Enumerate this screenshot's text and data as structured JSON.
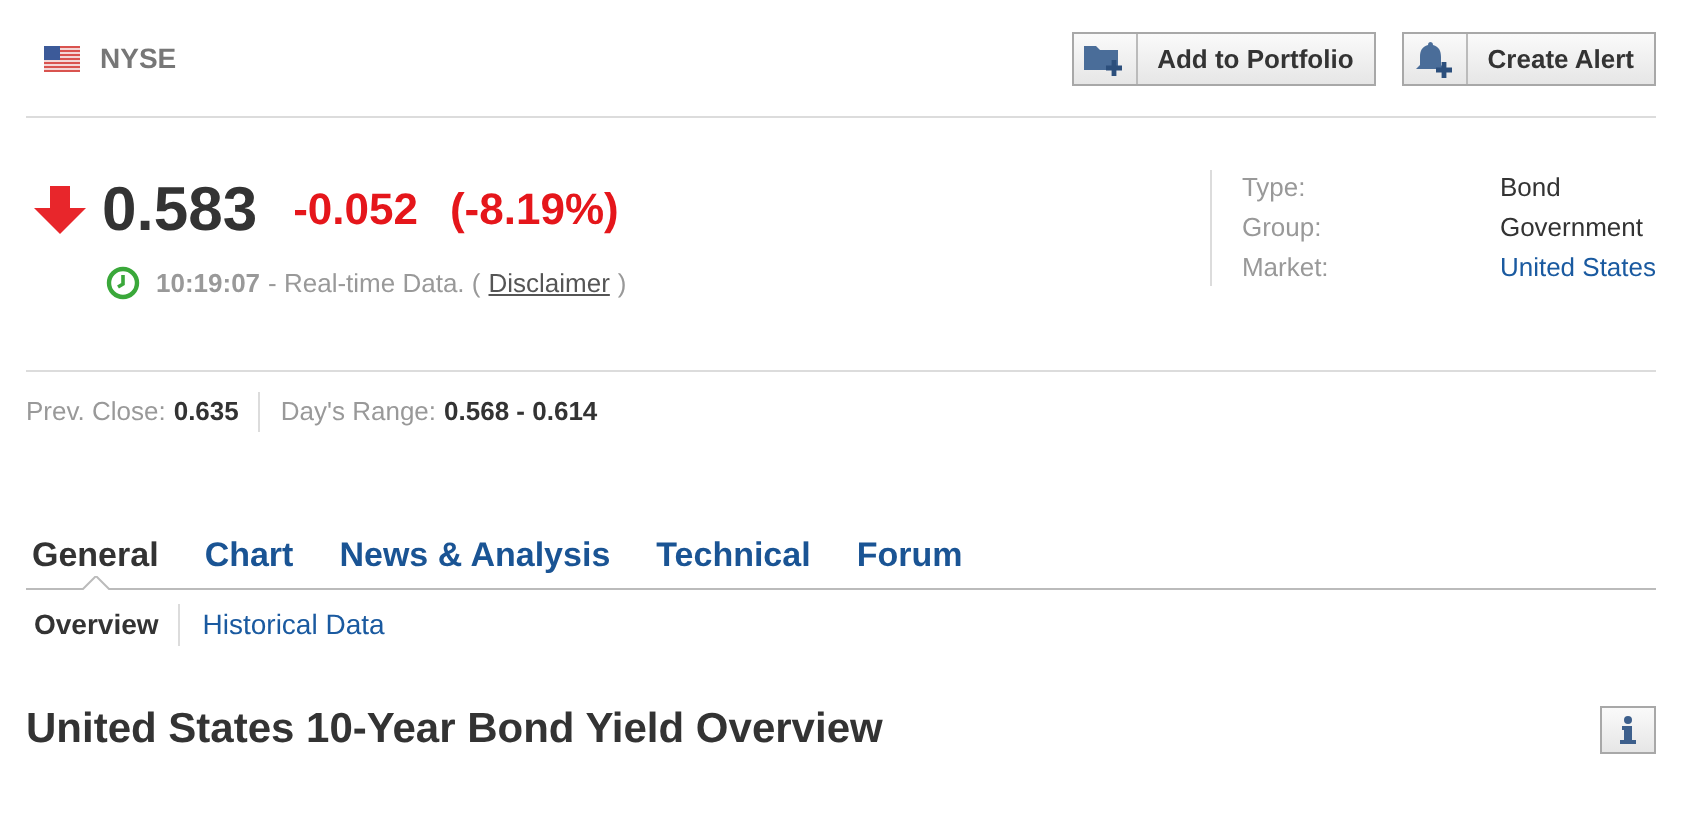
{
  "exchange": "NYSE",
  "actions": [
    {
      "label": "Add to Portfolio",
      "kind": "portfolio"
    },
    {
      "label": "Create Alert",
      "kind": "alert"
    }
  ],
  "quote": {
    "kind": "down",
    "price": "0.583",
    "change": "-0.052",
    "change_percent": "(-8.19%)",
    "time": "10:19:07",
    "realtime_note": "- Real-time Data. (",
    "disclaimer": "Disclaimer",
    "close_paren": ")"
  },
  "info": [
    {
      "label": "Type:",
      "value": "Bond",
      "link": false
    },
    {
      "label": "Group:",
      "value": "Government",
      "link": false
    },
    {
      "label": "Market:",
      "value": "United States",
      "link": true
    }
  ],
  "stats": [
    {
      "label": "Prev. Close:",
      "value": "0.635"
    },
    {
      "label": "Day's Range:",
      "value": "0.568 - 0.614"
    }
  ],
  "tabs": [
    {
      "label": "General",
      "selected": true
    },
    {
      "label": "Chart",
      "selected": false
    },
    {
      "label": "News & Analysis",
      "selected": false
    },
    {
      "label": "Technical",
      "selected": false
    },
    {
      "label": "Forum",
      "selected": false
    }
  ],
  "subtabs": [
    {
      "label": "Overview",
      "selected": true
    },
    {
      "label": "Historical Data",
      "selected": false
    }
  ],
  "heading": "United States 10-Year Bond Yield Overview"
}
